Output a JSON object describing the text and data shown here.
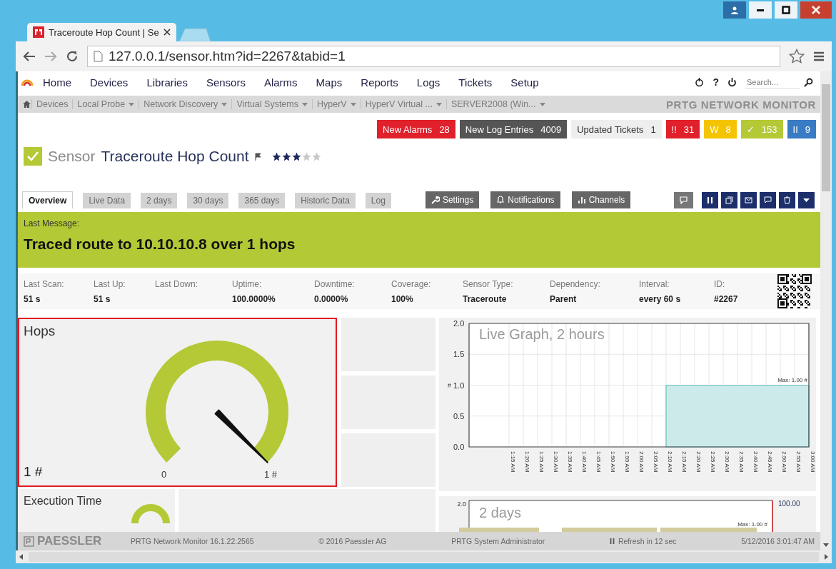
{
  "browser": {
    "tab": {
      "title": "Traceroute Hop Count | Se"
    },
    "url": "127.0.0.1/sensor.htm?id=2267&tabid=1"
  },
  "nav": {
    "items": [
      "Home",
      "Devices",
      "Libraries",
      "Sensors",
      "Alarms",
      "Maps",
      "Reports",
      "Logs",
      "Tickets",
      "Setup"
    ],
    "help": "?",
    "search": {
      "placeholder": "Search..."
    }
  },
  "breadcrumb": {
    "items": [
      {
        "label": "Devices",
        "dropdown": false
      },
      {
        "label": "Local Probe",
        "dropdown": true
      },
      {
        "label": "Network Discovery",
        "dropdown": true
      },
      {
        "label": "Virtual Systems",
        "dropdown": true
      },
      {
        "label": "HyperV",
        "dropdown": true
      },
      {
        "label": "HyperV Virtual ...",
        "dropdown": true
      },
      {
        "label": "SERVER2008 (Win...",
        "dropdown": true
      }
    ],
    "brand": "PRTG NETWORK MONITOR"
  },
  "alerts": [
    {
      "label": "New Alarms",
      "count": "28",
      "color": "#e0202a"
    },
    {
      "label": "New Log Entries",
      "count": "4009",
      "color": "#555555"
    },
    {
      "label": "Updated Tickets",
      "count": "1",
      "color": "#eeeeee"
    },
    {
      "label": "!!",
      "count": "31",
      "color": "#e0202a"
    },
    {
      "label": "W",
      "count": "8",
      "color": "#f5c400"
    },
    {
      "label": "✓",
      "count": "153",
      "color": "#b4c935"
    },
    {
      "label": "II",
      "count": "9",
      "color": "#3a7cc4"
    }
  ],
  "sensor": {
    "prefix": "Sensor",
    "name": "Traceroute Hop Count",
    "stars": 3
  },
  "tabs": [
    {
      "label": "Overview",
      "selected": true
    },
    {
      "label": "Live Data",
      "selected": false
    },
    {
      "label": "2 days",
      "selected": false
    },
    {
      "label": "30 days",
      "selected": false
    },
    {
      "label": "365 days",
      "selected": false
    },
    {
      "label": "Historic Data",
      "selected": false
    },
    {
      "label": "Log",
      "selected": false
    }
  ],
  "actions": [
    {
      "kind": "settings",
      "label": "Settings"
    },
    {
      "kind": "notifications",
      "label": "Notifications"
    },
    {
      "kind": "channels",
      "label": "Channels"
    }
  ],
  "message": {
    "label": "Last Message:",
    "text": "Traced route to 10.10.10.8 over 1 hops"
  },
  "stats": [
    {
      "label": "Last Scan:",
      "value": "51 s"
    },
    {
      "label": "Last Up:",
      "value": "51 s"
    },
    {
      "label": "Last Down:"
    },
    {
      "label": "Uptime:",
      "value": "100.0000%"
    },
    {
      "label": "Downtime:",
      "value": "0.0000%"
    },
    {
      "label": "Coverage:",
      "value": "100%"
    },
    {
      "label": "Sensor Type:",
      "value": "Traceroute"
    },
    {
      "label": "Dependency:",
      "value": "Parent"
    },
    {
      "label": "Interval:",
      "value": "every 60 s"
    },
    {
      "label": "ID:",
      "value": "#2267"
    }
  ],
  "gauge": {
    "title": "Hops",
    "value": "1 #",
    "min": "0",
    "max": "1 #",
    "level": 1
  },
  "exec_card": {
    "title": "Execution Time"
  },
  "live_graph": {
    "chart_data": {
      "type": "area",
      "title": "Live Graph, 2 hours",
      "ylabel": "#",
      "categories": [
        "1:15 AM",
        "1:20 AM",
        "1:25 AM",
        "1:30 AM",
        "1:35 AM",
        "1:40 AM",
        "1:45 AM",
        "1:50 AM",
        "1:55 AM",
        "2:00 AM",
        "2:05 AM",
        "2:10 AM",
        "2:15 AM",
        "2:20 AM",
        "2:25 AM",
        "2:30 AM",
        "2:35 AM",
        "2:40 AM",
        "2:45 AM",
        "2:50 AM",
        "2:55 AM",
        "3:00 AM"
      ],
      "values": [
        null,
        null,
        null,
        null,
        null,
        null,
        null,
        null,
        null,
        null,
        null,
        1,
        1,
        1,
        1,
        1,
        1,
        1,
        1,
        1,
        1,
        1
      ],
      "ylim": [
        0,
        2
      ],
      "grid": true,
      "yticks": [
        {
          "value": 0,
          "label": "0.0"
        },
        {
          "value": 0.5,
          "label": "0.5"
        },
        {
          "value": 1,
          "label": "1.0"
        },
        {
          "value": 1.5,
          "label": "1.5"
        },
        {
          "value": 2,
          "label": "2.0"
        }
      ],
      "annotations": [
        "Max: 1.00 #"
      ]
    }
  },
  "days_graph": {
    "title": "2 days",
    "ytick": "2.0",
    "reading": "100.00",
    "annotation": "Max: 1.00 #"
  },
  "footer": {
    "logo": "PAESSLER",
    "version": "PRTG Network Monitor 16.1.22.2565",
    "copyright": "© 2016 Paessler AG",
    "user": "PRTG System Administrator",
    "refresh": "Refresh in 12 sec",
    "datetime": "5/12/2016 3:01:47 AM"
  }
}
